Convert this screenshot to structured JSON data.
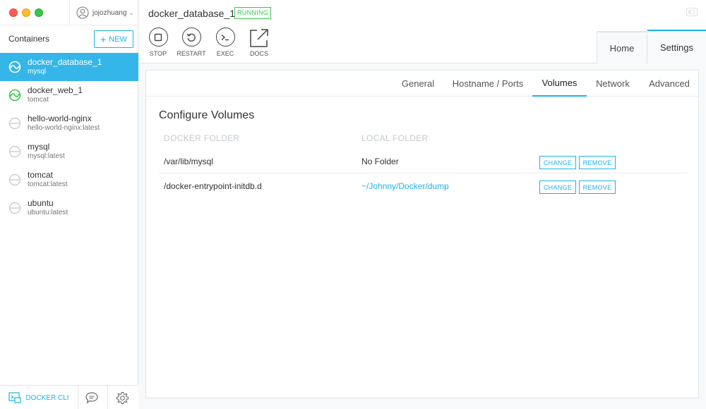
{
  "user": {
    "name": "jojozhuang"
  },
  "sidebar": {
    "title": "Containers",
    "new_label": "NEW",
    "items": [
      {
        "name": "docker_database_1",
        "image": "mysql",
        "state": "running"
      },
      {
        "name": "docker_web_1",
        "image": "tomcat",
        "state": "running"
      },
      {
        "name": "hello-world-nginx",
        "image": "hello-world-nginx:latest",
        "state": "stopped"
      },
      {
        "name": "mysql",
        "image": "mysql:latest",
        "state": "stopped"
      },
      {
        "name": "tomcat",
        "image": "tomcat:latest",
        "state": "stopped"
      },
      {
        "name": "ubuntu",
        "image": "ubuntu:latest",
        "state": "stopped"
      }
    ],
    "docker_cli_label": "DOCKER CLI"
  },
  "header": {
    "container_name": "docker_database_1",
    "status": "RUNNING",
    "actions": {
      "stop": "STOP",
      "restart": "RESTART",
      "exec": "EXEC",
      "docs": "DOCS"
    },
    "tabs": {
      "home": "Home",
      "settings": "Settings"
    }
  },
  "settings": {
    "subtabs": [
      "General",
      "Hostname / Ports",
      "Volumes",
      "Network",
      "Advanced"
    ],
    "active_subtab": "Volumes",
    "section_title": "Configure Volumes",
    "columns": {
      "docker": "DOCKER FOLDER",
      "local": "LOCAL FOLDER"
    },
    "rows": [
      {
        "docker_folder": "/var/lib/mysql",
        "local_folder": "No Folder",
        "change": "CHANGE",
        "remove": "REMOVE"
      },
      {
        "docker_folder": "/docker-entrypoint-initdb.d",
        "local_folder": "~/Johnny/Docker/dump",
        "change": "CHANGE",
        "remove": "REMOVE"
      }
    ]
  },
  "colors": {
    "accent": "#1bb2e8",
    "selected": "#35b6e8",
    "running": "#3ac64a",
    "stopped": "#c9cdd1"
  }
}
